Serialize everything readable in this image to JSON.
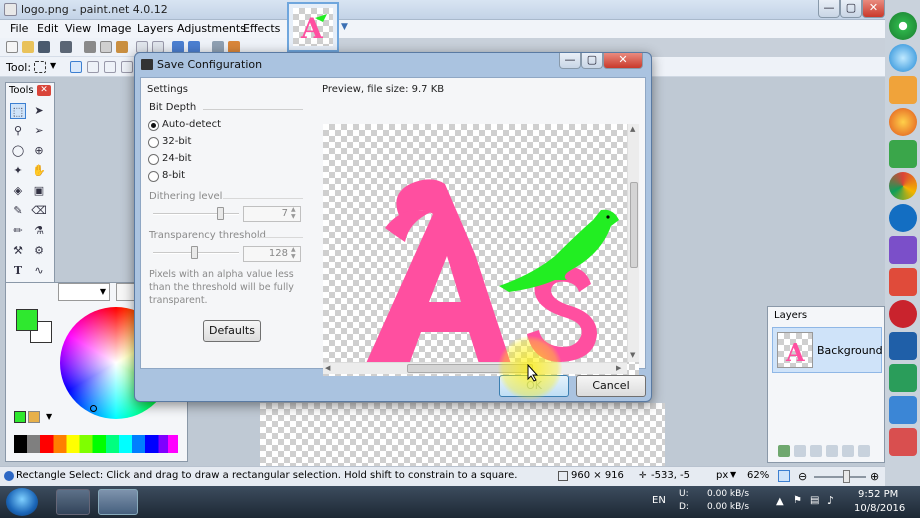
{
  "window": {
    "title": "logo.png - paint.net 4.0.12"
  },
  "menu": [
    "File",
    "Edit",
    "View",
    "Image",
    "Layers",
    "Adjustments",
    "Effects"
  ],
  "toolbar": {
    "tool_label": "Tool:"
  },
  "tools_panel": {
    "title": "Tools"
  },
  "layers_panel": {
    "title": "Layers",
    "layer_name": "Background"
  },
  "dialog": {
    "title": "Save Configuration",
    "settings_label": "Settings",
    "preview_label": "Preview, file size: 9.7 KB",
    "bit_depth_label": "Bit Depth",
    "options": [
      {
        "label": "Auto-detect",
        "selected": true
      },
      {
        "label": "32-bit",
        "selected": false
      },
      {
        "label": "24-bit",
        "selected": false
      },
      {
        "label": "8-bit",
        "selected": false
      }
    ],
    "dithering_label": "Dithering level",
    "dithering_value": "7",
    "transparency_label": "Transparency threshold",
    "transparency_value": "128",
    "note": "Pixels with an alpha value less than the threshold will be fully transparent.",
    "defaults_label": "Defaults",
    "ok_label": "OK",
    "cancel_label": "Cancel"
  },
  "statusbar": {
    "hint": "Rectangle Select: Click and drag to draw a rectangular selection. Hold shift to constrain to a square.",
    "image_size": "960 × 916",
    "cursor_pos": "-533, -5",
    "units": "px",
    "zoom": "62%"
  },
  "taskbar": {
    "language": "EN",
    "net_up_label": "U:",
    "net_down_label": "D:",
    "net_up": "0.00 kB/s",
    "net_down": "0.00 kB/s",
    "time": "9:52 PM",
    "date": "10/8/2016"
  },
  "colors": {
    "primary": "#2fe82f",
    "secondary": "#ffffff",
    "logo_pink": "#ff4fa0",
    "bird_green": "#22ee22"
  }
}
